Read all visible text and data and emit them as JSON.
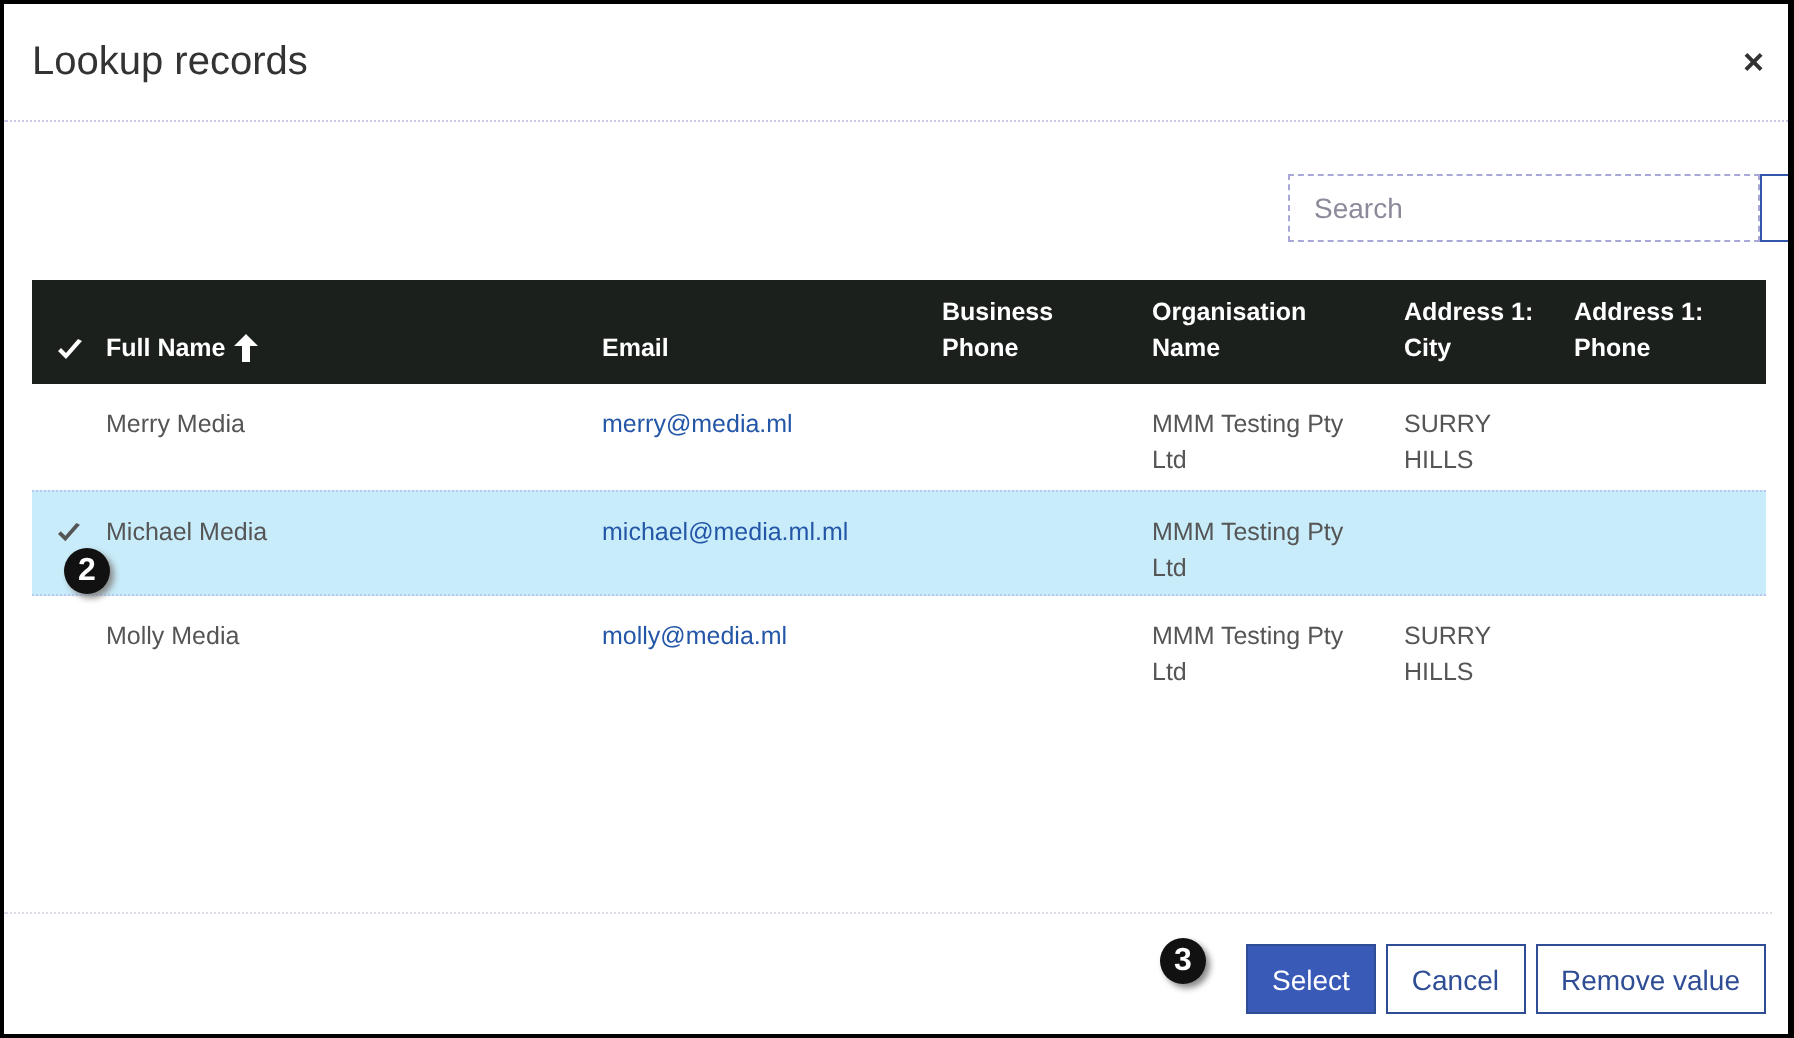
{
  "dialog": {
    "title": "Lookup records",
    "close": "×"
  },
  "search": {
    "placeholder": "Search"
  },
  "table": {
    "columns": [
      {
        "label": "Full Name",
        "sorted": true
      },
      {
        "label": "Email",
        "sorted": false
      },
      {
        "label": "Business Phone",
        "sorted": false
      },
      {
        "label": "Organisation Name",
        "sorted": false
      },
      {
        "label": "Address 1: City",
        "sorted": false
      },
      {
        "label": "Address 1: Phone",
        "sorted": false
      }
    ],
    "rows": [
      {
        "selected": false,
        "cells": [
          "Merry Media",
          "merry@media.ml",
          "",
          "MMM Testing Pty Ltd",
          "SURRY HILLS",
          ""
        ]
      },
      {
        "selected": true,
        "callout": "2",
        "cells": [
          "Michael Media",
          "michael@media.ml.ml",
          "",
          "MMM Testing Pty Ltd",
          "",
          ""
        ]
      },
      {
        "selected": false,
        "cells": [
          "Molly Media",
          "molly@media.ml",
          "",
          "MMM Testing Pty Ltd",
          "SURRY HILLS",
          ""
        ]
      }
    ]
  },
  "footer": {
    "callout": "3",
    "buttons": [
      {
        "label": "Select",
        "primary": true
      },
      {
        "label": "Cancel",
        "primary": false
      },
      {
        "label": "Remove value",
        "primary": false
      }
    ]
  }
}
